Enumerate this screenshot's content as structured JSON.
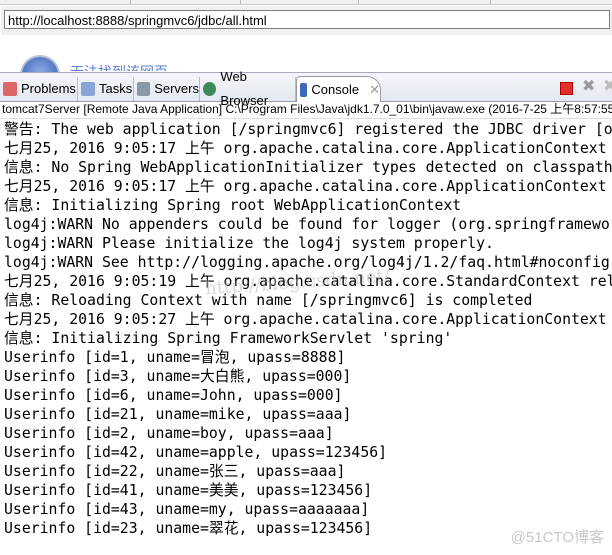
{
  "browser": {
    "url": "http://localhost:8888/springmvc6/jdbc/all.html",
    "page_text": "无法找到该网页"
  },
  "tabs": [
    {
      "label": "Problems",
      "icon": "problems-icon",
      "color": "#c04040"
    },
    {
      "label": "Tasks",
      "icon": "tasks-icon",
      "color": "#4070c0"
    },
    {
      "label": "Servers",
      "icon": "servers-icon",
      "color": "#607080"
    },
    {
      "label": "Web Browser",
      "icon": "globe-icon",
      "color": "#2f8f4f"
    },
    {
      "label": "Console",
      "icon": "console-icon",
      "color": "#3060b0",
      "active": true
    }
  ],
  "console": {
    "description": "tomcat7Server [Remote Java Application] C:\\Program Files\\Java\\jdk1.7.0_01\\bin\\javaw.exe (2016-7-25 上午8:57:55)",
    "lines": [
      "警告: The web application [/springmvc6] registered the JDBC driver [o",
      "七月25, 2016 9:05:17 上午 org.apache.catalina.core.ApplicationContext l",
      "信息: No Spring WebApplicationInitializer types detected on classpath",
      "七月25, 2016 9:05:17 上午 org.apache.catalina.core.ApplicationContext l",
      "信息: Initializing Spring root WebApplicationContext",
      "log4j:WARN No appenders could be found for logger (org.springframewo",
      "log4j:WARN Please initialize the log4j system properly.",
      "log4j:WARN See http://logging.apache.org/log4j/1.2/faq.html#noconfig",
      "七月25, 2016 9:05:19 上午 org.apache.catalina.core.StandardContext relo",
      "信息: Reloading Context with name [/springmvc6] is completed",
      "七月25, 2016 9:05:27 上午 org.apache.catalina.core.ApplicationContext l",
      "信息: Initializing Spring FrameworkServlet 'spring'",
      "Userinfo [id=1, uname=冒泡, upass=8888]",
      "Userinfo [id=3, uname=大白熊, upass=000]",
      "Userinfo [id=6, uname=John, upass=000]",
      "Userinfo [id=21, uname=mike, upass=aaa]",
      "Userinfo [id=2, uname=boy, upass=aaa]",
      "Userinfo [id=42, uname=apple, upass=123456]",
      "Userinfo [id=22, uname=张三, upass=aaa]",
      "Userinfo [id=41, uname=美美, upass=123456]",
      "Userinfo [id=43, uname=my, upass=aaaaaaa]",
      "Userinfo [id=23, uname=翠花, upass=123456]"
    ]
  },
  "watermarks": {
    "blog": "http://blog.csdn.net/",
    "site": "@51CTO博客"
  }
}
